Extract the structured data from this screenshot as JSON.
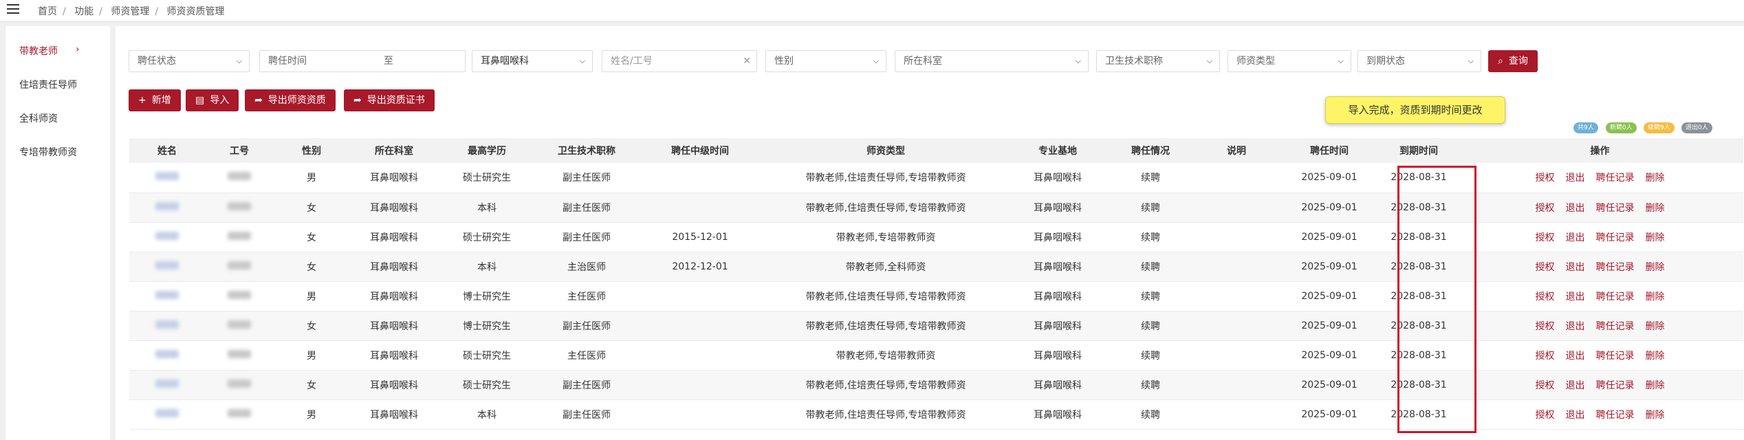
{
  "breadcrumb": [
    "首页",
    "功能",
    "师资管理",
    "师资资质管理"
  ],
  "sidebar": {
    "items": [
      {
        "label": "带教老师",
        "active": true
      },
      {
        "label": "住培责任导师",
        "active": false
      },
      {
        "label": "全科师资",
        "active": false
      },
      {
        "label": "专培带教师资",
        "active": false
      }
    ]
  },
  "filters": {
    "appoint_status": "聘任状态",
    "appoint_time": "聘任时间",
    "appoint_time_to": "至",
    "department": "耳鼻咽喉科",
    "name_placeholder": "姓名/工号",
    "gender": "性别",
    "section": "所在科室",
    "title": "卫生技术职称",
    "teacher_type": "师资类型",
    "expire_status": "到期状态",
    "search_label": "查询"
  },
  "actions": {
    "add_label": "新增",
    "import_label": "导入",
    "export_teachers_label": "导出师资资质",
    "export_cert_label": "导出资质证书"
  },
  "toast": "导入完成，资质到期时间更改",
  "badges": [
    {
      "label": "共9人",
      "color": "#6fb1d9"
    },
    {
      "label": "新聘0人",
      "color": "#8cc152"
    },
    {
      "label": "续聘9人",
      "color": "#f6bb42"
    },
    {
      "label": "退出0人",
      "color": "#8a9399"
    }
  ],
  "table": {
    "headers": [
      "姓名",
      "工号",
      "性别",
      "所在科室",
      "最高学历",
      "卫生技术职称",
      "聘任中级时间",
      "师资类型",
      "专业基地",
      "聘任情况",
      "说明",
      "聘任时间",
      "到期时间",
      "操作"
    ],
    "ops": [
      "授权",
      "退出",
      "聘任记录",
      "删除"
    ],
    "rows": [
      {
        "gender": "男",
        "dept": "耳鼻咽喉科",
        "edu": "硕士研究生",
        "title": "副主任医师",
        "mid": "",
        "type": "带教老师,住培责任导师,专培带教师资",
        "base": "耳鼻咽喉科",
        "status": "续聘",
        "note": "",
        "start": "2025-09-01",
        "end": "2028-08-31"
      },
      {
        "gender": "女",
        "dept": "耳鼻咽喉科",
        "edu": "本科",
        "title": "副主任医师",
        "mid": "",
        "type": "带教老师,住培责任导师,专培带教师资",
        "base": "耳鼻咽喉科",
        "status": "续聘",
        "note": "",
        "start": "2025-09-01",
        "end": "2028-08-31"
      },
      {
        "gender": "女",
        "dept": "耳鼻咽喉科",
        "edu": "硕士研究生",
        "title": "副主任医师",
        "mid": "2015-12-01",
        "type": "带教老师,专培带教师资",
        "base": "耳鼻咽喉科",
        "status": "续聘",
        "note": "",
        "start": "2025-09-01",
        "end": "2028-08-31"
      },
      {
        "gender": "女",
        "dept": "耳鼻咽喉科",
        "edu": "本科",
        "title": "主治医师",
        "mid": "2012-12-01",
        "type": "带教老师,全科师资",
        "base": "耳鼻咽喉科",
        "status": "续聘",
        "note": "",
        "start": "2025-09-01",
        "end": "2028-08-31"
      },
      {
        "gender": "男",
        "dept": "耳鼻咽喉科",
        "edu": "博士研究生",
        "title": "主任医师",
        "mid": "",
        "type": "带教老师,住培责任导师,专培带教师资",
        "base": "耳鼻咽喉科",
        "status": "续聘",
        "note": "",
        "start": "2025-09-01",
        "end": "2028-08-31"
      },
      {
        "gender": "女",
        "dept": "耳鼻咽喉科",
        "edu": "博士研究生",
        "title": "副主任医师",
        "mid": "",
        "type": "带教老师,住培责任导师,专培带教师资",
        "base": "耳鼻咽喉科",
        "status": "续聘",
        "note": "",
        "start": "2025-09-01",
        "end": "2028-08-31"
      },
      {
        "gender": "男",
        "dept": "耳鼻咽喉科",
        "edu": "硕士研究生",
        "title": "主任医师",
        "mid": "",
        "type": "带教老师,专培带教师资",
        "base": "耳鼻咽喉科",
        "status": "续聘",
        "note": "",
        "start": "2025-09-01",
        "end": "2028-08-31"
      },
      {
        "gender": "女",
        "dept": "耳鼻咽喉科",
        "edu": "硕士研究生",
        "title": "副主任医师",
        "mid": "",
        "type": "带教老师,住培责任导师,专培带教师资",
        "base": "耳鼻咽喉科",
        "status": "续聘",
        "note": "",
        "start": "2025-09-01",
        "end": "2028-08-31"
      },
      {
        "gender": "男",
        "dept": "耳鼻咽喉科",
        "edu": "本科",
        "title": "副主任医师",
        "mid": "",
        "type": "带教老师,住培责任导师,专培带教师资",
        "base": "耳鼻咽喉科",
        "status": "续聘",
        "note": "",
        "start": "2025-09-01",
        "end": "2028-08-31"
      }
    ]
  },
  "colors": {
    "accent": "#a8192a",
    "highlight": "#d0102a",
    "toast": "#fdf468"
  }
}
